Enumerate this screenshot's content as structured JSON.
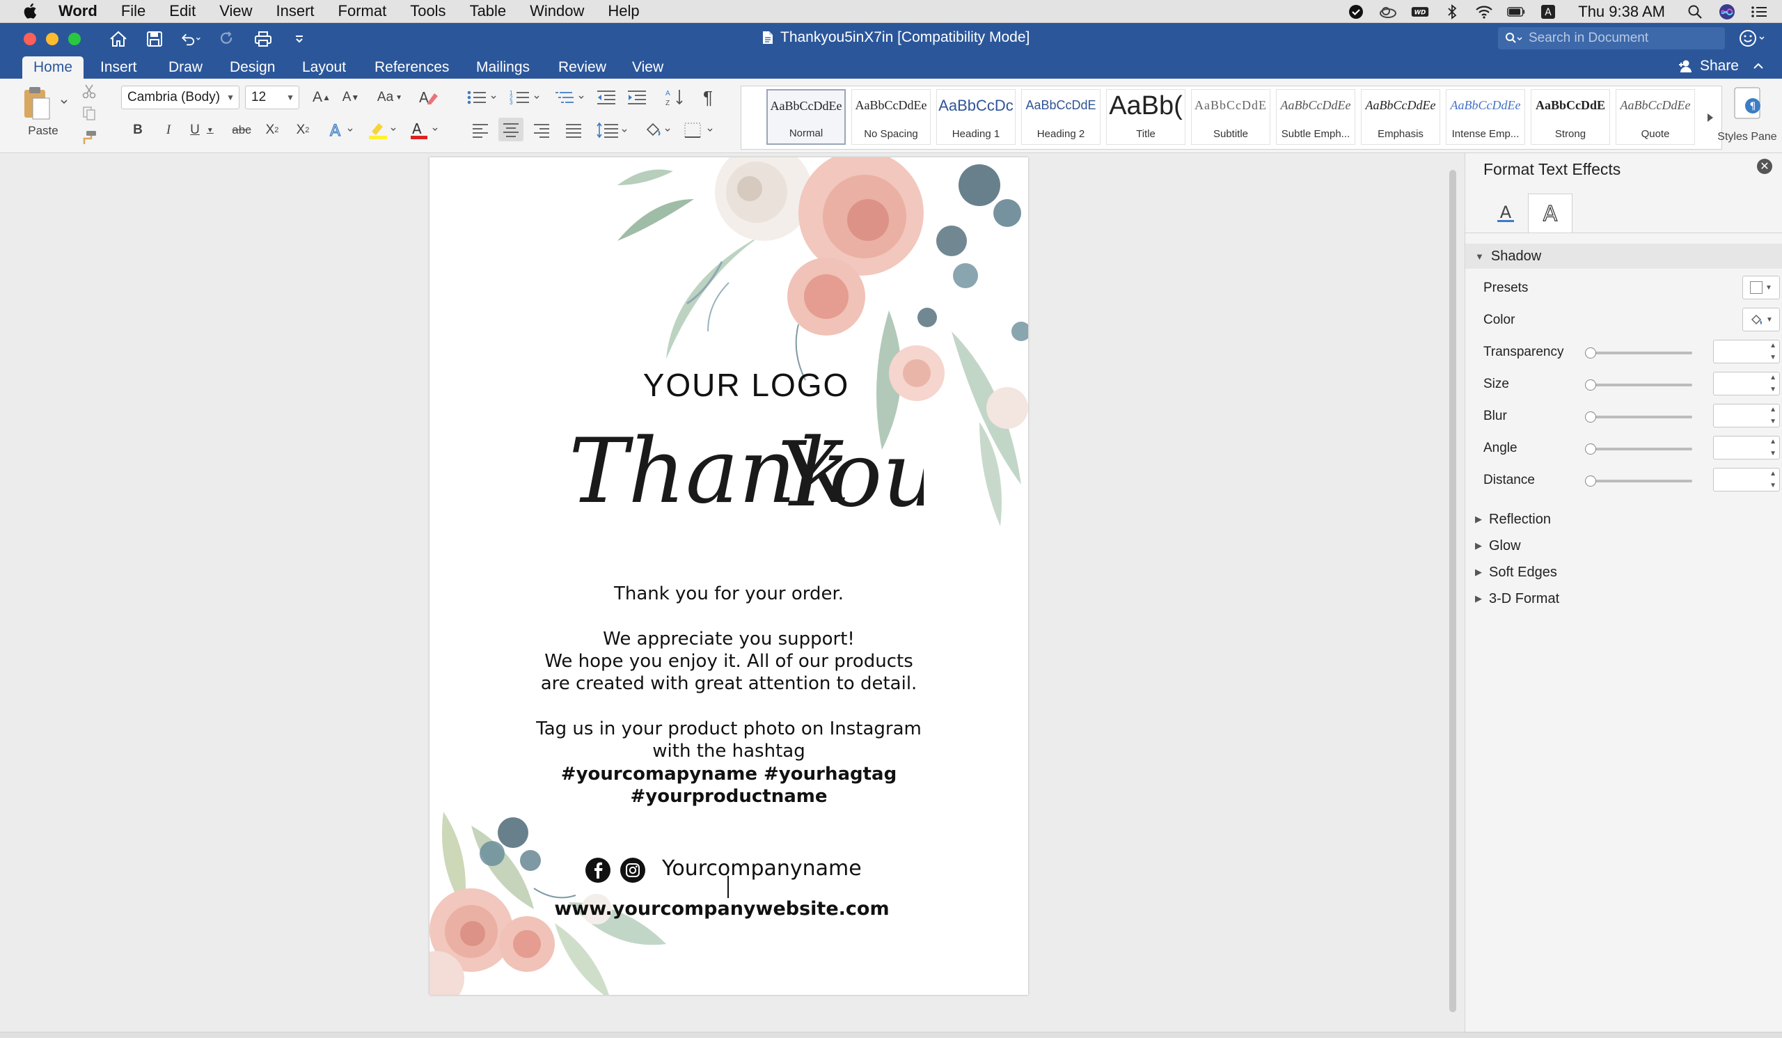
{
  "menubar": {
    "items": [
      "Word",
      "File",
      "Edit",
      "View",
      "Insert",
      "Format",
      "Tools",
      "Table",
      "Window",
      "Help"
    ],
    "clock": "Thu 9:38 AM",
    "status_icons": [
      "checkmark-icon",
      "cloud-icon",
      "wd-icon",
      "bluetooth-icon",
      "wifi-icon",
      "battery-icon",
      "input-a-icon",
      "search-icon",
      "siri-icon",
      "list-icon"
    ]
  },
  "titlebar": {
    "title": "Thankyou5inX7in [Compatibility Mode]",
    "search_placeholder": "Search in Document"
  },
  "tabs": [
    "Home",
    "Insert",
    "Draw",
    "Design",
    "Layout",
    "References",
    "Mailings",
    "Review",
    "View"
  ],
  "share_label": "Share",
  "ribbon": {
    "paste_label": "Paste",
    "font_name": "Cambria (Body)",
    "font_size": "12",
    "styles_pane_label": "Styles Pane",
    "styles": [
      {
        "sample": "AaBbCcDdEe",
        "name": "Normal"
      },
      {
        "sample": "AaBbCcDdEe",
        "name": "No Spacing"
      },
      {
        "sample": "AaBbCcDc",
        "name": "Heading 1"
      },
      {
        "sample": "AaBbCcDdE",
        "name": "Heading 2"
      },
      {
        "sample": "AaBb(",
        "name": "Title"
      },
      {
        "sample": "AaBbCcDdE",
        "name": "Subtitle"
      },
      {
        "sample": "AaBbCcDdEe",
        "name": "Subtle Emph..."
      },
      {
        "sample": "AaBbCcDdEe",
        "name": "Emphasis"
      },
      {
        "sample": "AaBbCcDdEe",
        "name": "Intense Emp..."
      },
      {
        "sample": "AaBbCcDdE",
        "name": "Strong"
      },
      {
        "sample": "AaBbCcDdEe",
        "name": "Quote"
      }
    ]
  },
  "document": {
    "logo": "YOUR LOGO",
    "script_line1": "Thank",
    "script_line2": "You",
    "line1": "Thank you for your order.",
    "line2": "We appreciate you support!",
    "line3": "We hope you enjoy it. All of our products",
    "line4": "are created with great attention to detail.",
    "line5": "Tag us in your product photo on Instagram",
    "line6": "with the hashtag",
    "line7": "#yourcomapyname #yourhagtag",
    "line8": "#yourproductname",
    "company": "Yourcompanyname",
    "website": "www.yourcompanywebsite.com"
  },
  "pane": {
    "title": "Format Text Effects",
    "shadow_label": "Shadow",
    "rows": [
      {
        "label": "Presets"
      },
      {
        "label": "Color"
      },
      {
        "label": "Transparency"
      },
      {
        "label": "Size"
      },
      {
        "label": "Blur"
      },
      {
        "label": "Angle"
      },
      {
        "label": "Distance"
      }
    ],
    "collapsed_sections": [
      "Reflection",
      "Glow",
      "Soft Edges",
      "3-D Format"
    ]
  },
  "colors": {
    "word_blue": "#2b579a",
    "flower_pink": "#eab0a4",
    "leaf_green": "#7fa58a",
    "eucalyptus": "#4d6a78"
  }
}
